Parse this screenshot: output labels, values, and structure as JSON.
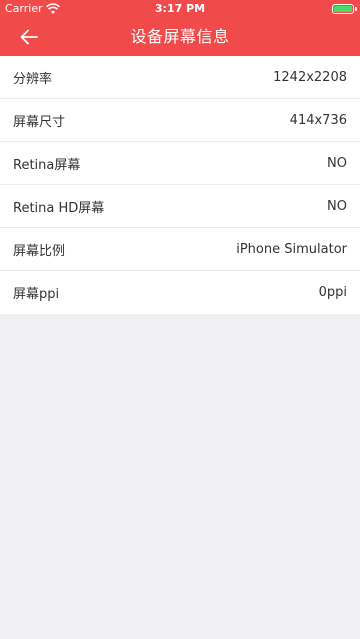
{
  "status_bar": {
    "carrier": "Carrier",
    "time": "3:17 PM",
    "battery_color": "#4cd964"
  },
  "header": {
    "title": "设备屏幕信息",
    "back_icon": "arrow-left-icon",
    "background": "#f04a4a"
  },
  "rows": [
    {
      "label": "分辨率",
      "value": "1242x2208"
    },
    {
      "label": "屏幕尺寸",
      "value": "414x736"
    },
    {
      "label": "Retina屏幕",
      "value": "NO"
    },
    {
      "label": "Retina HD屏幕",
      "value": "NO"
    },
    {
      "label": "屏幕比例",
      "value": "iPhone Simulator"
    },
    {
      "label": "屏幕ppi",
      "value": "0ppi"
    }
  ]
}
